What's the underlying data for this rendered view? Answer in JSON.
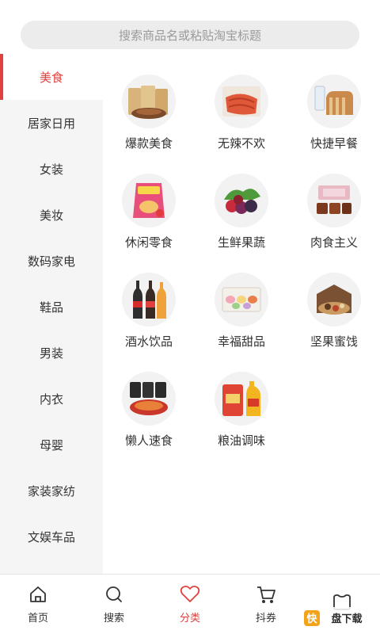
{
  "search": {
    "placeholder": "搜索商品名或粘贴淘宝标题"
  },
  "sidebar": {
    "items": [
      {
        "label": "美食",
        "active": true
      },
      {
        "label": "居家日用",
        "active": false
      },
      {
        "label": "女装",
        "active": false
      },
      {
        "label": "美妆",
        "active": false
      },
      {
        "label": "数码家电",
        "active": false
      },
      {
        "label": "鞋品",
        "active": false
      },
      {
        "label": "男装",
        "active": false
      },
      {
        "label": "内衣",
        "active": false
      },
      {
        "label": "母婴",
        "active": false
      },
      {
        "label": "家装家纺",
        "active": false
      },
      {
        "label": "文娱车品",
        "active": false
      }
    ]
  },
  "categories": [
    {
      "label": "爆款美食",
      "icon": "snack-pack-icon"
    },
    {
      "label": "无辣不欢",
      "icon": "spicy-meat-icon"
    },
    {
      "label": "快捷早餐",
      "icon": "bread-milk-icon"
    },
    {
      "label": "休闲零食",
      "icon": "chips-bag-icon"
    },
    {
      "label": "生鲜果蔬",
      "icon": "fruit-icon"
    },
    {
      "label": "肉食主义",
      "icon": "meat-box-icon"
    },
    {
      "label": "酒水饮品",
      "icon": "bottles-icon"
    },
    {
      "label": "幸福甜品",
      "icon": "macaron-box-icon"
    },
    {
      "label": "坚果蜜饯",
      "icon": "nuts-box-icon"
    },
    {
      "label": "懒人速食",
      "icon": "instant-noodles-icon"
    },
    {
      "label": "粮油调味",
      "icon": "rice-oil-icon"
    }
  ],
  "tabbar": {
    "items": [
      {
        "label": "首页",
        "icon": "home-icon",
        "active": false
      },
      {
        "label": "搜索",
        "icon": "search-icon",
        "active": false
      },
      {
        "label": "分类",
        "icon": "heart-icon",
        "active": true
      },
      {
        "label": "抖券",
        "icon": "cart-icon",
        "active": false
      },
      {
        "label": "",
        "icon": "profile-icon",
        "active": false
      }
    ]
  },
  "watermark": {
    "text": "快盘下载"
  },
  "colors": {
    "accent": "#e0413d",
    "sidebar_bg": "#f5f5f5",
    "search_bg": "#ececec"
  }
}
